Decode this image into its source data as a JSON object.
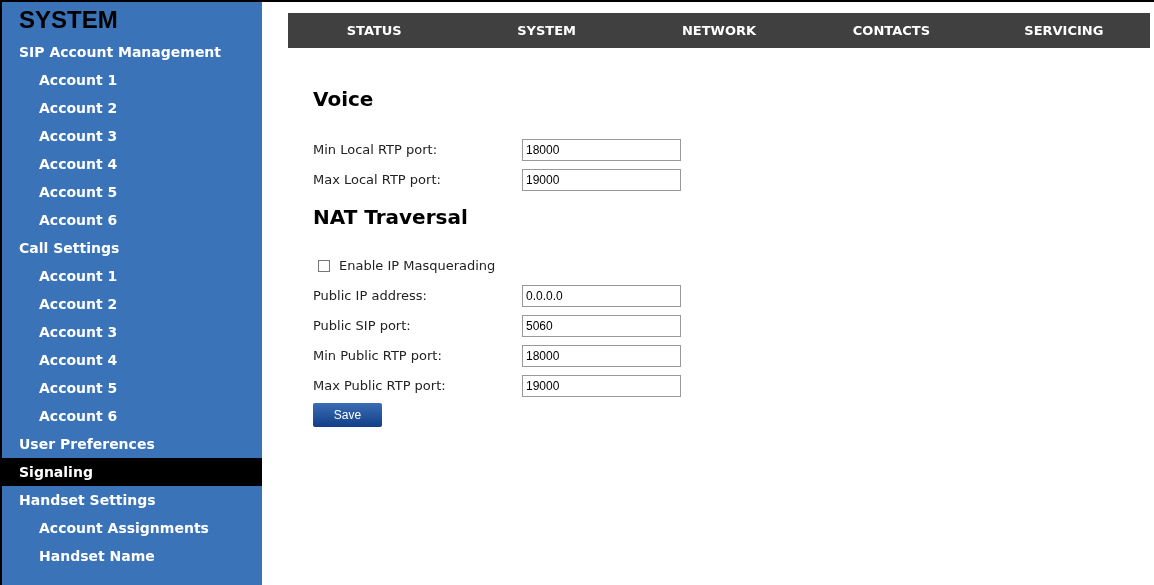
{
  "sidebar": {
    "title": "SYSTEM",
    "items": [
      {
        "label": "SIP Account Management",
        "selected": false,
        "children": [
          {
            "label": "Account 1",
            "selected": false
          },
          {
            "label": "Account 2",
            "selected": false
          },
          {
            "label": "Account 3",
            "selected": false
          },
          {
            "label": "Account 4",
            "selected": false
          },
          {
            "label": "Account 5",
            "selected": false
          },
          {
            "label": "Account 6",
            "selected": false
          }
        ]
      },
      {
        "label": "Call Settings",
        "selected": false,
        "children": [
          {
            "label": "Account 1",
            "selected": false
          },
          {
            "label": "Account 2",
            "selected": false
          },
          {
            "label": "Account 3",
            "selected": false
          },
          {
            "label": "Account 4",
            "selected": false
          },
          {
            "label": "Account 5",
            "selected": false
          },
          {
            "label": "Account 6",
            "selected": false
          }
        ]
      },
      {
        "label": "User Preferences",
        "selected": false
      },
      {
        "label": "Signaling",
        "selected": true
      },
      {
        "label": "Handset Settings",
        "selected": false,
        "children": [
          {
            "label": "Account Assignments",
            "selected": false
          },
          {
            "label": "Handset Name",
            "selected": false
          }
        ]
      }
    ]
  },
  "nav": [
    {
      "label": "STATUS",
      "selected": false
    },
    {
      "label": "SYSTEM",
      "selected": false
    },
    {
      "label": "NETWORK",
      "selected": false
    },
    {
      "label": "CONTACTS",
      "selected": false
    },
    {
      "label": "SERVICING",
      "selected": false
    }
  ],
  "sections": [
    {
      "title": "Voice",
      "fields": [
        {
          "kind": "text",
          "label": "Min Local RTP port:",
          "value": "18000"
        },
        {
          "kind": "text",
          "label": "Max Local RTP port:",
          "value": "19000"
        }
      ]
    },
    {
      "title": "NAT Traversal",
      "fields": [
        {
          "kind": "checkbox",
          "label": "Enable IP Masquerading",
          "checked": false
        },
        {
          "kind": "text",
          "label": "Public IP address:",
          "value": "0.0.0.0"
        },
        {
          "kind": "text",
          "label": "Public SIP port:",
          "value": "5060"
        },
        {
          "kind": "text",
          "label": "Min Public RTP port:",
          "value": "18000"
        },
        {
          "kind": "text",
          "label": "Max Public RTP port:",
          "value": "19000"
        }
      ]
    }
  ],
  "save_button": "Save"
}
